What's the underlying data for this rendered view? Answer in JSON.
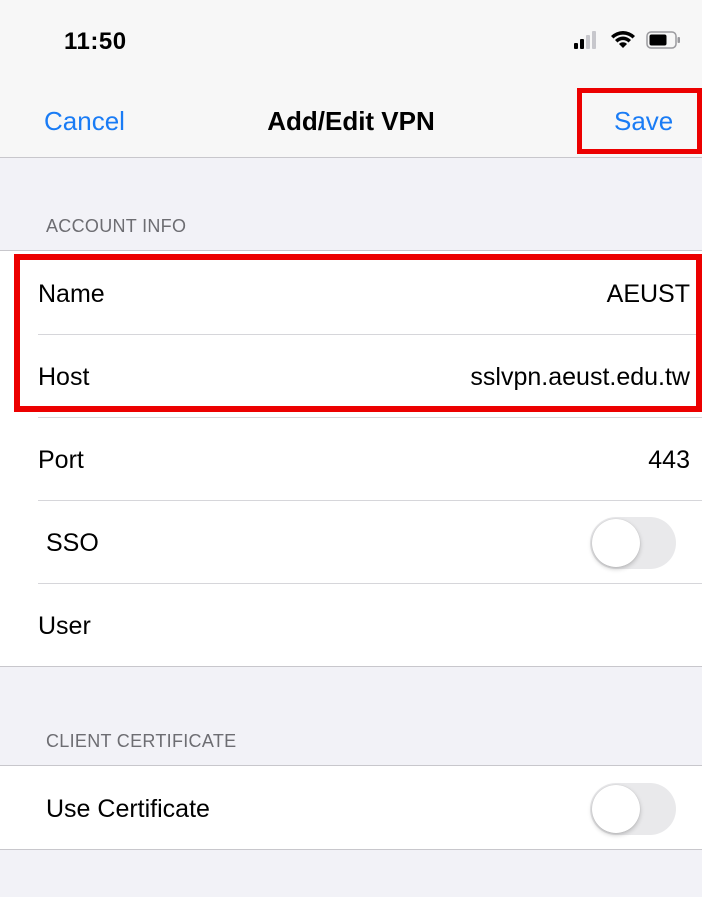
{
  "status_bar": {
    "time": "11:50",
    "icons": [
      "signal-icon",
      "wifi-icon",
      "battery-icon"
    ]
  },
  "nav": {
    "cancel_label": "Cancel",
    "title": "Add/Edit VPN",
    "save_label": "Save",
    "accent_color": "#1a7cf5"
  },
  "sections": {
    "account_info": {
      "header": "ACCOUNT INFO",
      "name_label": "Name",
      "name_value": "AEUST",
      "host_label": "Host",
      "host_value": "sslvpn.aeust.edu.tw",
      "port_label": "Port",
      "port_value": "443",
      "sso_label": "SSO",
      "sso_enabled": false,
      "user_label": "User"
    },
    "client_certificate": {
      "header": "CLIENT CERTIFICATE",
      "use_certificate_label": "Use Certificate",
      "use_certificate_enabled": false
    }
  },
  "highlight_color": "#ec0000"
}
